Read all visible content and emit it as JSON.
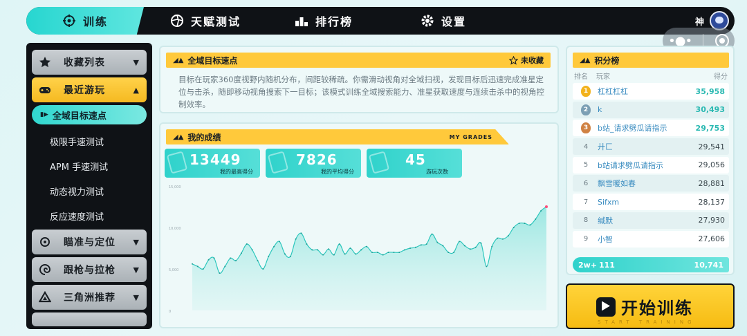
{
  "nav": {
    "tabs": [
      {
        "label": "训练",
        "icon": "crosshair-icon",
        "active": true
      },
      {
        "label": "天赋测试",
        "icon": "aperture-icon",
        "active": false
      },
      {
        "label": "排行榜",
        "icon": "podium-icon",
        "active": false
      },
      {
        "label": "设置",
        "icon": "gear-icon",
        "active": false
      }
    ],
    "user_name": "神"
  },
  "sidebar": {
    "groups": [
      {
        "label": "收藏列表",
        "icon": "star-icon"
      },
      {
        "label": "最近游玩",
        "icon": "gamepad-icon"
      },
      {
        "label": "瞄准与定位",
        "icon": "target-icon"
      },
      {
        "label": "跟枪与拉枪",
        "icon": "swirl-icon"
      },
      {
        "label": "三角洲推荐",
        "icon": "delta-icon"
      }
    ],
    "sub_items": [
      {
        "label": "全域目标速点",
        "active": true
      },
      {
        "label": "极限手速测试"
      },
      {
        "label": "APM 手速测试"
      },
      {
        "label": "动态视力测试"
      },
      {
        "label": "反应速度测试"
      }
    ]
  },
  "mode": {
    "title": "全域目标速点",
    "favorite_label": "未收藏",
    "description": "目标在玩家360度视野内随机分布，间距较稀疏。你需滑动视角对全域扫视，发现目标后迅速完成准星定位与击杀，随即移动视角搜索下一目标；该模式训练全域搜索能力、准星获取速度与连续击杀中的视角控制效率。"
  },
  "grades": {
    "title": "我的成绩",
    "title_en": "MY GRADES",
    "stats": [
      {
        "value": "13449",
        "label": "我的最高得分"
      },
      {
        "value": "7826",
        "label": "我的平均得分"
      },
      {
        "value": "45",
        "label": "游玩次数"
      }
    ]
  },
  "chart_data": {
    "type": "area",
    "title": "",
    "xlabel": "",
    "ylabel": "",
    "ylim": [
      0,
      15000
    ],
    "y_ticks": [
      "15,000",
      "10,000",
      "5,000",
      "0"
    ],
    "grid": false,
    "color": "#2cc7bd",
    "highlight_color": "#ff4f7b",
    "values": [
      5600,
      5300,
      5000,
      6100,
      6300,
      4500,
      5300,
      6300,
      6000,
      6900,
      8000,
      7300,
      6000,
      5000,
      6500,
      7700,
      8300,
      6800,
      6500,
      8600,
      9300,
      8000,
      7300,
      7300,
      6700,
      7400,
      6700,
      8000,
      6800,
      7500,
      6800,
      7300,
      7700,
      7000,
      7000,
      6700,
      7000,
      7000,
      7000,
      7300,
      7500,
      7600,
      7900,
      8000,
      9200,
      8200,
      7800,
      7000,
      7000,
      8300,
      7800,
      7400,
      7600,
      8100,
      5300,
      7700,
      8700,
      8600,
      9000,
      10000,
      10500,
      10500,
      10300,
      11000,
      12000,
      12500
    ]
  },
  "leaderboard": {
    "title": "积分榜",
    "col_rank": "排名",
    "col_player": "玩家",
    "col_score": "得分",
    "rows": [
      {
        "rank": "1",
        "name": "杠杠杠杠",
        "score": "35,958",
        "medal": "gold"
      },
      {
        "rank": "2",
        "name": "k",
        "score": "30,493",
        "medal": "silver"
      },
      {
        "rank": "3",
        "name": "b站_请求劈瓜请指示",
        "score": "29,753",
        "medal": "bronze"
      },
      {
        "rank": "4",
        "name": "廾匚",
        "score": "29,541"
      },
      {
        "rank": "5",
        "name": "b站请求劈瓜请指示",
        "score": "29,056"
      },
      {
        "rank": "6",
        "name": "飘雪暖如春",
        "score": "28,881"
      },
      {
        "rank": "7",
        "name": "Sifxm",
        "score": "28,137"
      },
      {
        "rank": "8",
        "name": "缄默",
        "score": "27,930"
      },
      {
        "rank": "9",
        "name": "小智",
        "score": "27,606"
      }
    ],
    "my_rank": {
      "rank": "2w+",
      "name": "111",
      "score": "10,741"
    }
  },
  "start": {
    "label": "开始训练",
    "sub": "START TRAINING"
  },
  "colors": {
    "accent": "#2fd2cb",
    "highlight": "#ffc93b",
    "dark": "#0f1216"
  }
}
